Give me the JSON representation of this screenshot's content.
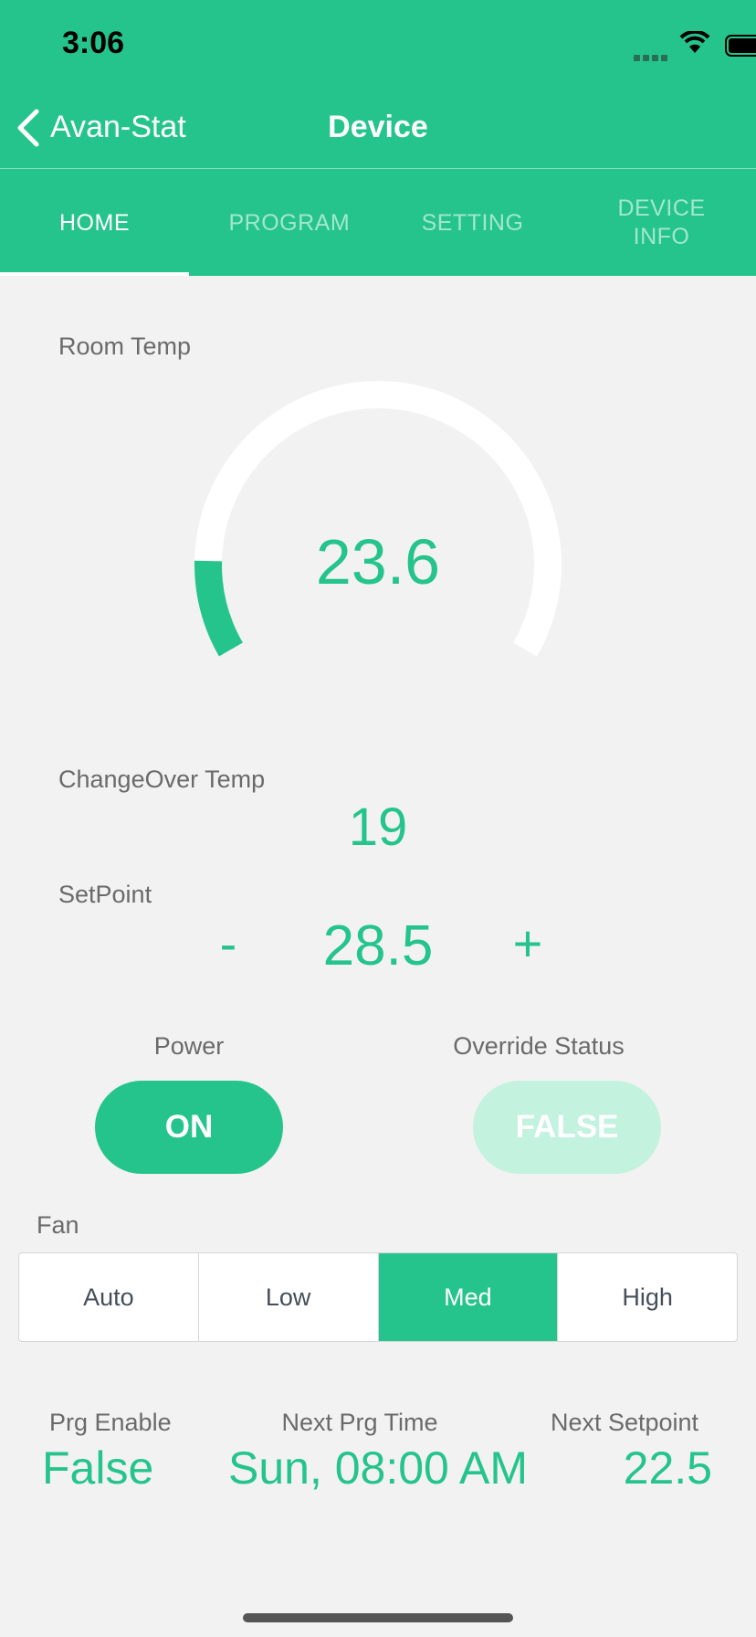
{
  "status_bar": {
    "time": "3:06"
  },
  "nav": {
    "back_label": "Avan-Stat",
    "title": "Device"
  },
  "tabs": [
    {
      "label": "HOME",
      "active": true
    },
    {
      "label": "PROGRAM",
      "active": false
    },
    {
      "label": "SETTING",
      "active": false
    },
    {
      "label": "DEVICE INFO",
      "active": false
    }
  ],
  "room_temp": {
    "label": "Room Temp",
    "value": "23.6",
    "gauge_fill_fraction": 0.13
  },
  "changeover": {
    "label": "ChangeOver Temp",
    "value": "19"
  },
  "setpoint": {
    "label": "SetPoint",
    "minus": "-",
    "value": "28.5",
    "plus": "+"
  },
  "power": {
    "label": "Power",
    "button": "ON"
  },
  "override": {
    "label": "Override Status",
    "button": "FALSE"
  },
  "fan": {
    "label": "Fan",
    "options": [
      "Auto",
      "Low",
      "Med",
      "High"
    ],
    "selected": "Med"
  },
  "program": {
    "prg_enable_label": "Prg Enable",
    "prg_enable_value": "False",
    "next_time_label": "Next Prg Time",
    "next_time_value": "Sun, 08:00 AM",
    "next_setpoint_label": "Next Setpoint",
    "next_setpoint_value": "22.5"
  },
  "colors": {
    "accent": "#25c48d",
    "accent_light": "#c3f2df",
    "background": "#f2f2f2"
  }
}
